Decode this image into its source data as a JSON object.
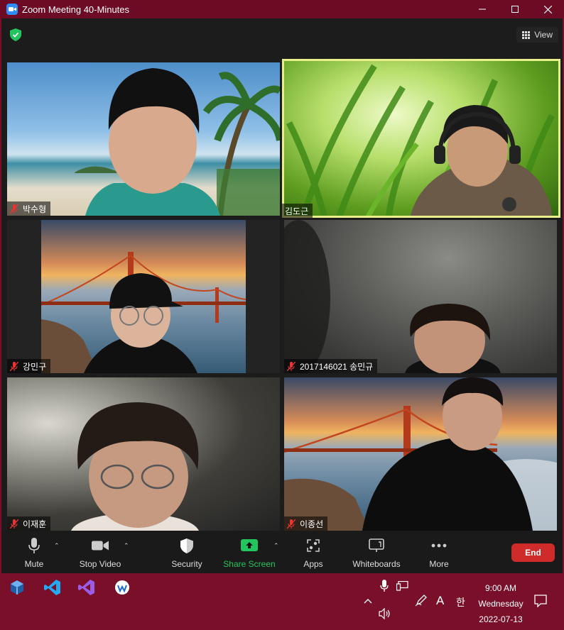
{
  "window": {
    "title": "Zoom Meeting 40-Minutes",
    "controls": [
      "minimize",
      "maximize",
      "close"
    ]
  },
  "header": {
    "view_label": "View"
  },
  "participants": [
    {
      "name": "박수형",
      "muted": true,
      "active_speaker": false
    },
    {
      "name": "김도근",
      "muted": false,
      "active_speaker": true
    },
    {
      "name": "강민구",
      "muted": true,
      "active_speaker": false
    },
    {
      "name": "2017146021 송민규",
      "muted": true,
      "active_speaker": false
    },
    {
      "name": "이재훈",
      "muted": true,
      "active_speaker": false
    },
    {
      "name": "이종선",
      "muted": true,
      "active_speaker": false
    }
  ],
  "toolbar": {
    "mute_label": "Mute",
    "stop_video_label": "Stop Video",
    "security_label": "Security",
    "share_screen_label": "Share Screen",
    "apps_label": "Apps",
    "whiteboards_label": "Whiteboards",
    "more_label": "More",
    "end_label": "End"
  },
  "taskbar": {
    "apps": [
      "virtualbox-icon",
      "vscode-icon",
      "visual-studio-icon",
      "whale-browser-icon"
    ],
    "ime_letter": "A",
    "ime_korean": "한",
    "time": "9:00 AM",
    "day": "Wednesday",
    "date": "2022-07-13"
  },
  "colors": {
    "titlebar": "#6d0b25",
    "taskbar": "#7a0f2a",
    "active_speaker_border": "#e9ef8a",
    "share_green": "#22c55e",
    "end_red": "#d02b2b"
  }
}
